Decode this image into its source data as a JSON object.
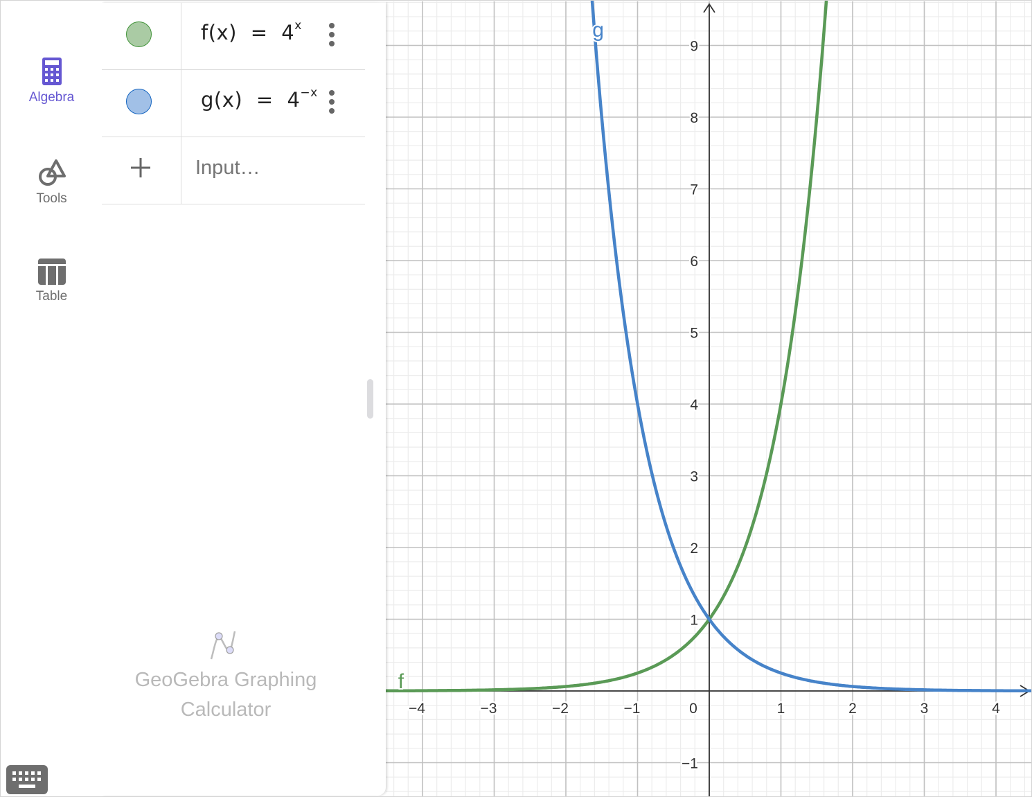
{
  "app": {
    "name": "GeoGebra Graphing Calculator"
  },
  "sidenav": {
    "items": [
      {
        "label": "Algebra",
        "icon": "calculator-icon",
        "active": true
      },
      {
        "label": "Tools",
        "icon": "tools-shapes-icon",
        "active": false
      },
      {
        "label": "Table",
        "icon": "table-icon",
        "active": false
      }
    ]
  },
  "algebra": {
    "entries": [
      {
        "name": "f",
        "lhs": "f(x)",
        "eq": "=",
        "base": "4",
        "exponent": "x",
        "color": "#43943b",
        "fill": "#aacba4",
        "more_icon": "more-vertical-icon"
      },
      {
        "name": "g",
        "lhs": "g(x)",
        "eq": "=",
        "base": "4",
        "exponent": "−x",
        "color": "#1565c0",
        "fill": "#a1c0e7",
        "more_icon": "more-vertical-icon"
      }
    ],
    "input": {
      "placeholder": "Input…",
      "value": "",
      "add_icon": "plus-icon"
    },
    "brand_line1": "GeoGebra Graphing",
    "brand_line2": "Calculator"
  },
  "keyboard": {
    "icon": "keyboard-icon"
  },
  "chart_data": {
    "type": "line",
    "title": "",
    "xlabel": "",
    "ylabel": "",
    "xlim": [
      -4.45,
      4.55
    ],
    "ylim": [
      -1.45,
      9.6
    ],
    "grid": true,
    "x_ticks": [
      -4,
      -3,
      -2,
      -1,
      0,
      1,
      2,
      3,
      4
    ],
    "x_tick_labels": [
      "−4",
      "−3",
      "−2",
      "−1",
      "0",
      "1",
      "2",
      "3",
      "4"
    ],
    "y_ticks": [
      -1,
      1,
      2,
      3,
      4,
      5,
      6,
      7,
      8,
      9
    ],
    "y_tick_labels": [
      "−1",
      "1",
      "2",
      "3",
      "4",
      "5",
      "6",
      "7",
      "8",
      "9"
    ],
    "series": [
      {
        "name": "f",
        "expression": "4^x",
        "base": 4,
        "sign": 1,
        "color": "#5a9a56",
        "label": "f",
        "label_x": -4.3
      },
      {
        "name": "g",
        "expression": "4^(-x)",
        "base": 4,
        "sign": -1,
        "color": "#4683c9",
        "label": "g",
        "label_x": -1.55
      }
    ],
    "intersection": [
      0,
      1
    ]
  }
}
